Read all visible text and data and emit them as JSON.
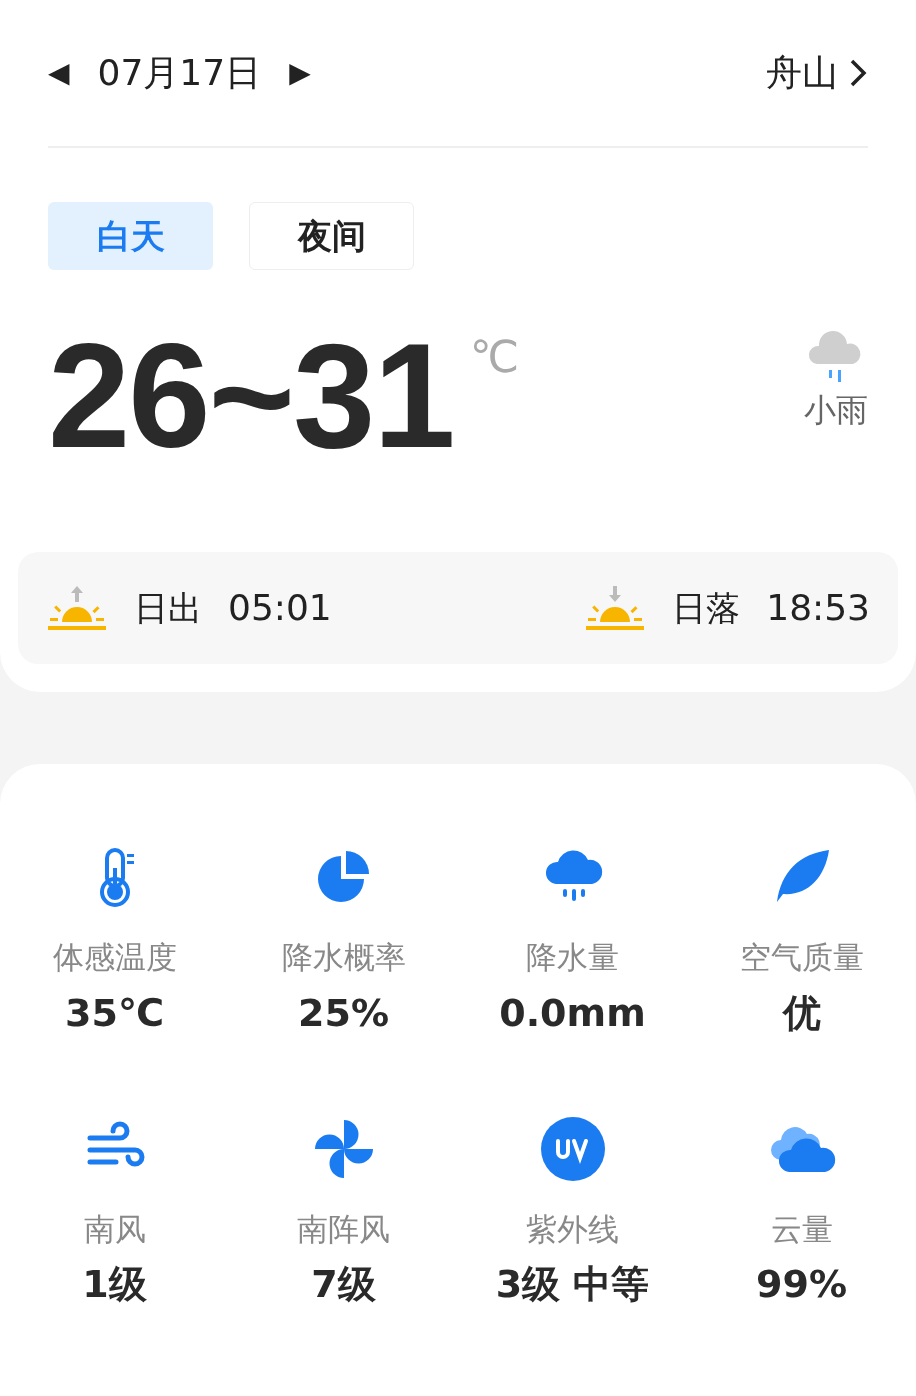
{
  "header": {
    "prev": "◀",
    "date": "07月17日",
    "next": "▶",
    "city": "舟山"
  },
  "tabs": [
    {
      "label": "白天",
      "selected": true
    },
    {
      "label": "夜间",
      "selected": false
    }
  ],
  "temperature": {
    "range": "26~31",
    "unit": "℃"
  },
  "condition": {
    "label": "小雨"
  },
  "sun": [
    {
      "kind": "sunrise",
      "label": "日出",
      "time": "05:01"
    },
    {
      "kind": "sunset",
      "label": "日落",
      "time": "18:53"
    }
  ],
  "metrics": [
    {
      "kind": "thermometer",
      "label": "体感温度",
      "value": "35℃"
    },
    {
      "kind": "pie",
      "label": "降水概率",
      "value": "25%"
    },
    {
      "kind": "rain",
      "label": "降水量",
      "value": "0.0mm"
    },
    {
      "kind": "leaf",
      "label": "空气质量",
      "value": "优"
    },
    {
      "kind": "wind",
      "label": "南风",
      "value": "1级"
    },
    {
      "kind": "gust",
      "label": "南阵风",
      "value": "7级"
    },
    {
      "kind": "uv",
      "label": "紫外线",
      "value": "3级 中等"
    },
    {
      "kind": "cloud",
      "label": "云量",
      "value": "99%"
    }
  ]
}
